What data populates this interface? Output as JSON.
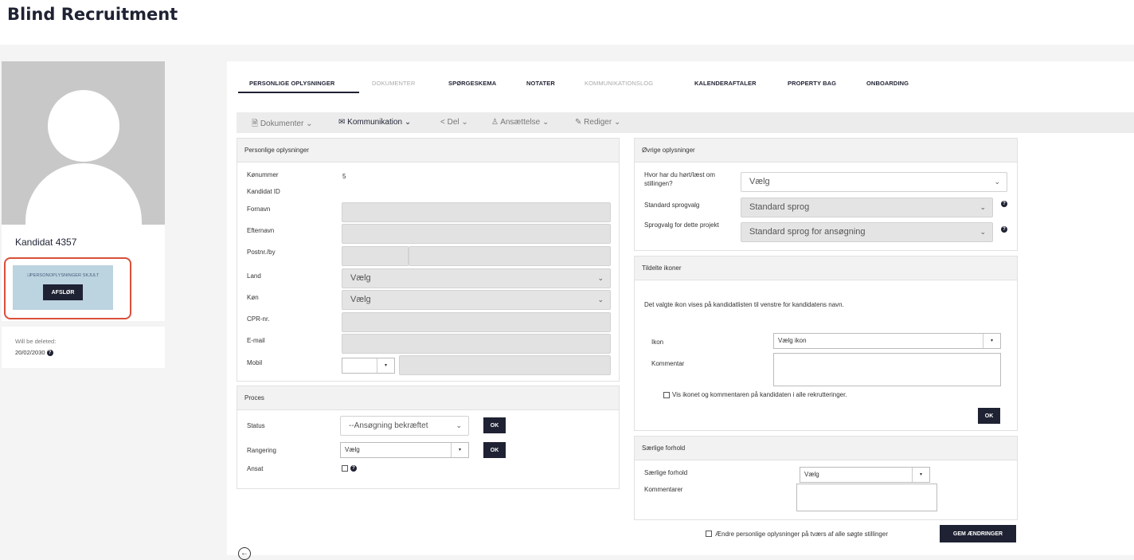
{
  "app": {
    "title": "Blind Recruitment"
  },
  "profile": {
    "name": "Kandidat 4357",
    "hidden_notice": "PERSONOPLYSNINGER SKJULT",
    "reveal_label": "AFSLØR",
    "delete_label": "Will be deleted:",
    "delete_date": "20/02/2030"
  },
  "tabs": [
    {
      "label": "PERSONLIGE OPLYSNINGER",
      "active": true
    },
    {
      "label": "DOKUMENTER",
      "disabled": true
    },
    {
      "label": "SPØRGESKEMA"
    },
    {
      "label": "NOTATER"
    },
    {
      "label": "KOMMUNIKATIONSLOG",
      "disabled": true
    },
    {
      "label": "KALENDERAFTALER"
    },
    {
      "label": "PROPERTY BAG"
    },
    {
      "label": "ONBOARDING"
    }
  ],
  "toolbar": {
    "documents": "Dokumenter",
    "communication": "Kommunikation",
    "share": "Del",
    "employment": "Ansættelse",
    "edit": "Rediger"
  },
  "personal": {
    "title": "Personlige oplysninger",
    "queue_label": "Kønummer",
    "queue_value": "5",
    "candidate_id_label": "Kandidat ID",
    "firstname_label": "Fornavn",
    "lastname_label": "Efternavn",
    "postal_label": "Postnr./by",
    "country_label": "Land",
    "country_value": "Vælg",
    "gender_label": "Køn",
    "gender_value": "Vælg",
    "cpr_label": "CPR-nr.",
    "email_label": "E-mail",
    "mobile_label": "Mobil"
  },
  "process": {
    "title": "Proces",
    "status_label": "Status",
    "status_value": "--Ansøgning bekræftet",
    "ranking_label": "Rangering",
    "ranking_value": "Vælg",
    "hired_label": "Ansat",
    "ok_label": "OK"
  },
  "other": {
    "title": "Øvrige oplysninger",
    "heard_label": "Hvor har du hørt/læst om stillingen?",
    "heard_value": "Vælg",
    "lang_label": "Standard sprogvalg",
    "lang_value": "Standard sprog",
    "proj_lang_label": "Sprogvalg for dette projekt",
    "proj_lang_value": "Standard sprog for ansøgning"
  },
  "icons": {
    "title": "Tildelte ikoner",
    "description": "Det valgte ikon vises på kandidatlisten til venstre for kandidatens navn.",
    "icon_label": "Ikon",
    "icon_value": "Vælg ikon",
    "comment_label": "Kommentar",
    "show_all_label": "Vis ikonet og kommentaren på kandidaten i alle rekrutteringer.",
    "ok_label": "OK"
  },
  "special": {
    "title": "Særlige forhold",
    "special_label": "Særlige forhold",
    "special_value": "Vælg",
    "comments_label": "Kommentarer"
  },
  "footer": {
    "change_all_label": "Ændre personlige oplysninger på tværs af alle søgte stillinger",
    "save_label": "GEM ÆNDRINGER"
  }
}
